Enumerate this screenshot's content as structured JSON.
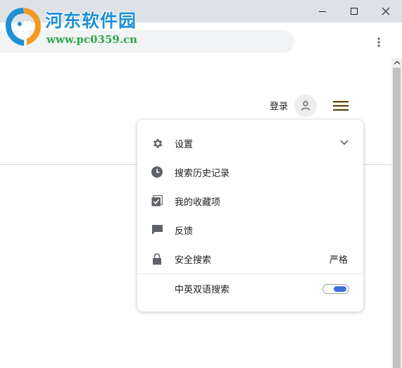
{
  "watermark": {
    "title": "河东软件园",
    "url": "www.pc0359.cn"
  },
  "window": {
    "controls": [
      "minimize-icon",
      "maximize-icon",
      "close-icon"
    ]
  },
  "toolbar": {
    "menu_icon": "more-vert-icon"
  },
  "header": {
    "login_label": "登录",
    "avatar_icon": "person-icon",
    "menu_icon": "hamburger-icon",
    "menu_accent_color": "#f4b400"
  },
  "menu": {
    "items": [
      {
        "icon": "gear-icon",
        "label": "设置",
        "right_icon": "chevron-down-icon"
      },
      {
        "icon": "clock-icon",
        "label": "搜索历史记录"
      },
      {
        "icon": "bookmark-check-icon",
        "label": "我的收藏项"
      },
      {
        "icon": "feedback-icon",
        "label": "反馈"
      },
      {
        "icon": "lock-icon",
        "label": "安全搜索",
        "value": "严格"
      },
      {
        "label": "中英双语搜索",
        "toggle": true
      }
    ]
  },
  "colors": {
    "accent_blue": "#3f6fdb",
    "titlebar": "#dee1e6",
    "icon_gray": "#5f6368"
  }
}
